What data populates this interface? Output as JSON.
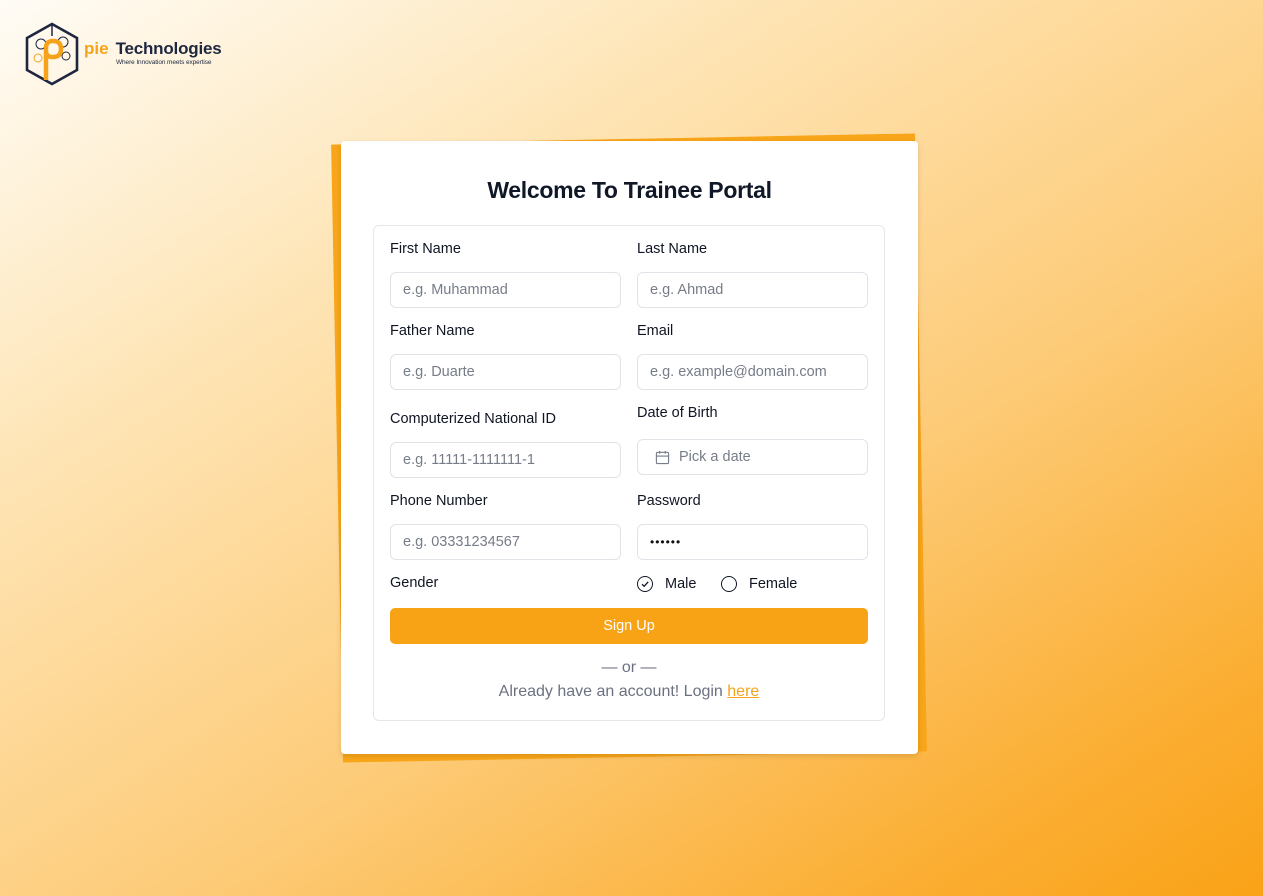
{
  "brand": {
    "name_accent": "pie",
    "name": "Technologies",
    "tagline": "Where Innovation meets expertise"
  },
  "form": {
    "title": "Welcome To Trainee Portal",
    "first_name": {
      "label": "First Name",
      "placeholder": "e.g. Muhammad"
    },
    "last_name": {
      "label": "Last Name",
      "placeholder": "e.g. Ahmad"
    },
    "father_name": {
      "label": "Father Name",
      "placeholder": "e.g. Duarte"
    },
    "email": {
      "label": "Email",
      "placeholder": "e.g. example@domain.com"
    },
    "cnic": {
      "label": "Computerized National ID",
      "placeholder": "e.g. 11111-1111111-1"
    },
    "dob": {
      "label": "Date of Birth",
      "placeholder": "Pick a date",
      "icon": "calendar-icon"
    },
    "phone": {
      "label": "Phone Number",
      "placeholder": "e.g. 03331234567"
    },
    "password": {
      "label": "Password",
      "value": "******"
    },
    "gender": {
      "label": "Gender",
      "options": [
        "Male",
        "Female"
      ],
      "selected": "Male"
    },
    "submit_label": "Sign Up",
    "divider": "— or —",
    "login_prompt": "Already have an account! Login",
    "login_link": "here"
  },
  "colors": {
    "accent": "#f8a316",
    "title": "#101727",
    "muted_text": "#6b7180",
    "brand_dark": "#1e2740"
  }
}
